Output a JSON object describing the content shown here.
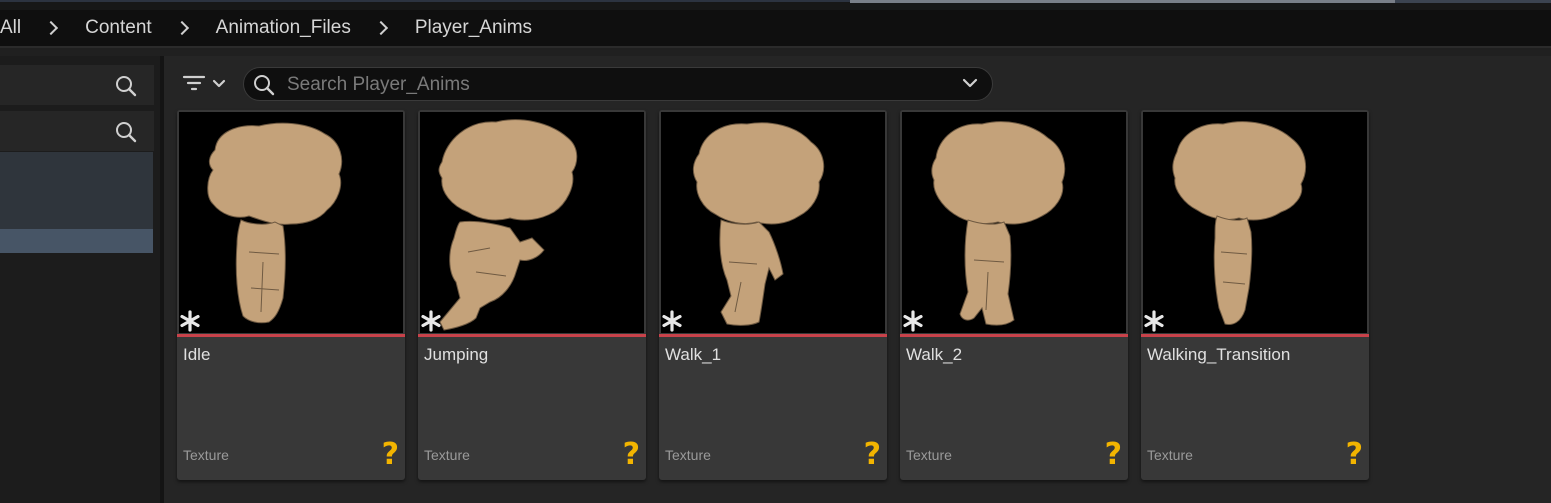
{
  "breadcrumb": {
    "items": [
      "All",
      "Content",
      "Animation_Files",
      "Player_Anims"
    ]
  },
  "search": {
    "placeholder": "Search Player_Anims",
    "value": ""
  },
  "assets": [
    {
      "name": "Idle",
      "type": "Texture"
    },
    {
      "name": "Jumping",
      "type": "Texture"
    },
    {
      "name": "Walk_1",
      "type": "Texture"
    },
    {
      "name": "Walk_2",
      "type": "Texture"
    },
    {
      "name": "Walking_Transition",
      "type": "Texture"
    }
  ],
  "icons": {
    "breadcrumb_separator": "chevron-right-icon",
    "filter": "filter-icon",
    "search": "search-icon",
    "dropdown": "chevron-down-icon",
    "modified": "asterisk-icon",
    "missing_thumbnail": "question-mark-icon"
  },
  "colors": {
    "accent_underline": "#c8424a",
    "question_mark": "#f2b400",
    "selection": "#475566",
    "sprite_tan": "#c4a27a"
  }
}
